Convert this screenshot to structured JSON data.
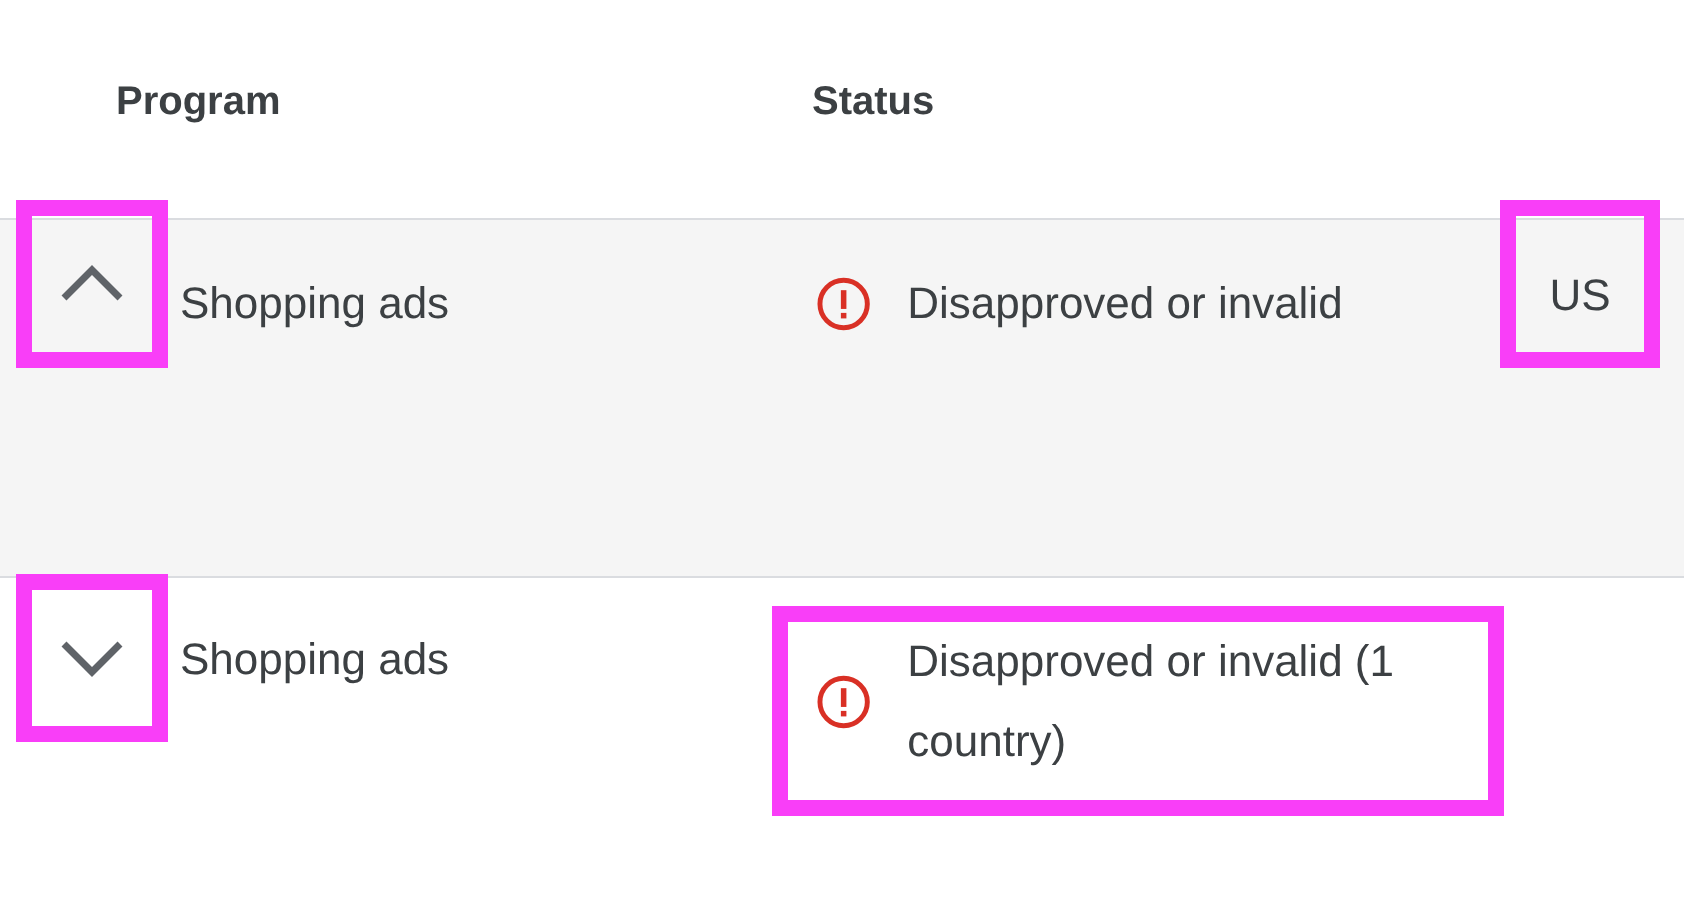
{
  "columns": [
    {
      "label": "Program"
    },
    {
      "label": "Status"
    }
  ],
  "rows": [
    {
      "expanded": true,
      "toggle_highlighted": true,
      "program": "Shopping ads",
      "status": {
        "kind": "error",
        "text": "Disapproved or invalid",
        "highlighted": false
      },
      "region": {
        "text": "US",
        "highlighted": true
      }
    },
    {
      "expanded": false,
      "toggle_highlighted": true,
      "program": "Shopping ads",
      "status": {
        "kind": "error",
        "text": "Disapproved or invalid (1 country)",
        "highlighted": true
      }
    }
  ]
}
